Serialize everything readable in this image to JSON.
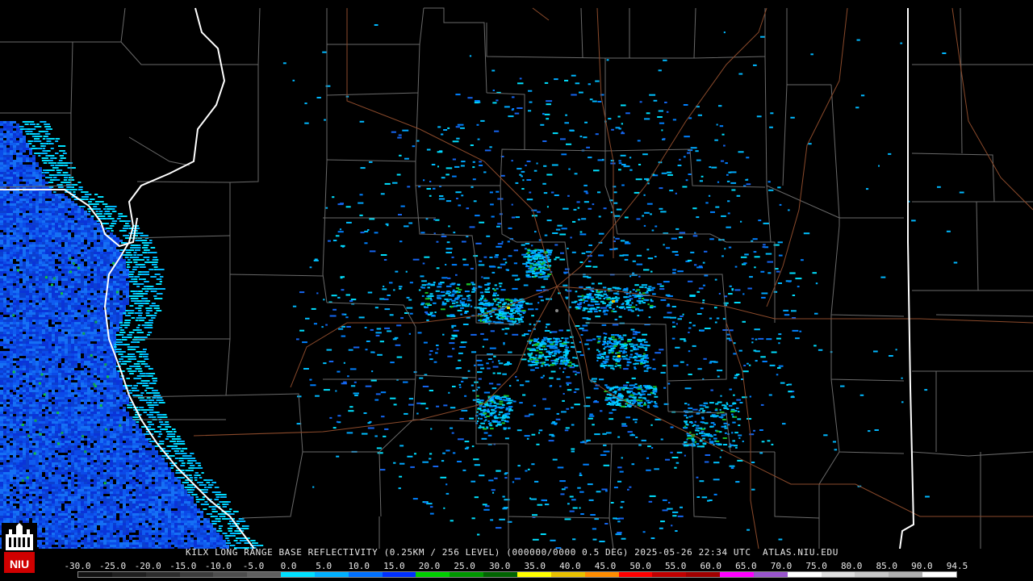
{
  "product": {
    "caption": "KILX LONG RANGE BASE REFLECTIVITY (0.25KM / 256 LEVEL) (000000/0000 0.5 DEG) 2025-05-26 22:34 UTC  ATLAS.NIU.EDU"
  },
  "logo": {
    "text": "NIU",
    "color": "#d00000"
  },
  "legend": {
    "ticks": [
      "-30.0",
      "-25.0",
      "-20.0",
      "-15.0",
      "-10.0",
      "-5.0",
      "0.0",
      "5.0",
      "10.0",
      "15.0",
      "20.0",
      "25.0",
      "30.0",
      "35.0",
      "40.0",
      "45.0",
      "50.0",
      "55.0",
      "60.0",
      "65.0",
      "70.0",
      "75.0",
      "80.0",
      "85.0",
      "90.0",
      "94.5"
    ],
    "colors": [
      "#111111",
      "#1e1e1e",
      "#2c2c2c",
      "#3c3c3c",
      "#4e4e4e",
      "#606060",
      "#00e0ff",
      "#00b0ff",
      "#0070ff",
      "#0030ff",
      "#00d000",
      "#009800",
      "#006400",
      "#ffff00",
      "#e8c000",
      "#ff8c00",
      "#ff0000",
      "#c00000",
      "#a00000",
      "#ff00ff",
      "#9955cc",
      "#ffffff",
      "#e0e0e0",
      "#c8c8c8",
      "#b0b0b0",
      "#ffffff"
    ]
  },
  "map": {
    "background": "#000000",
    "county_line_color": "#6a6a6a",
    "state_line_color": "#ffffff",
    "highway_color": "#8b4a2b",
    "radar_site": "KILX"
  }
}
